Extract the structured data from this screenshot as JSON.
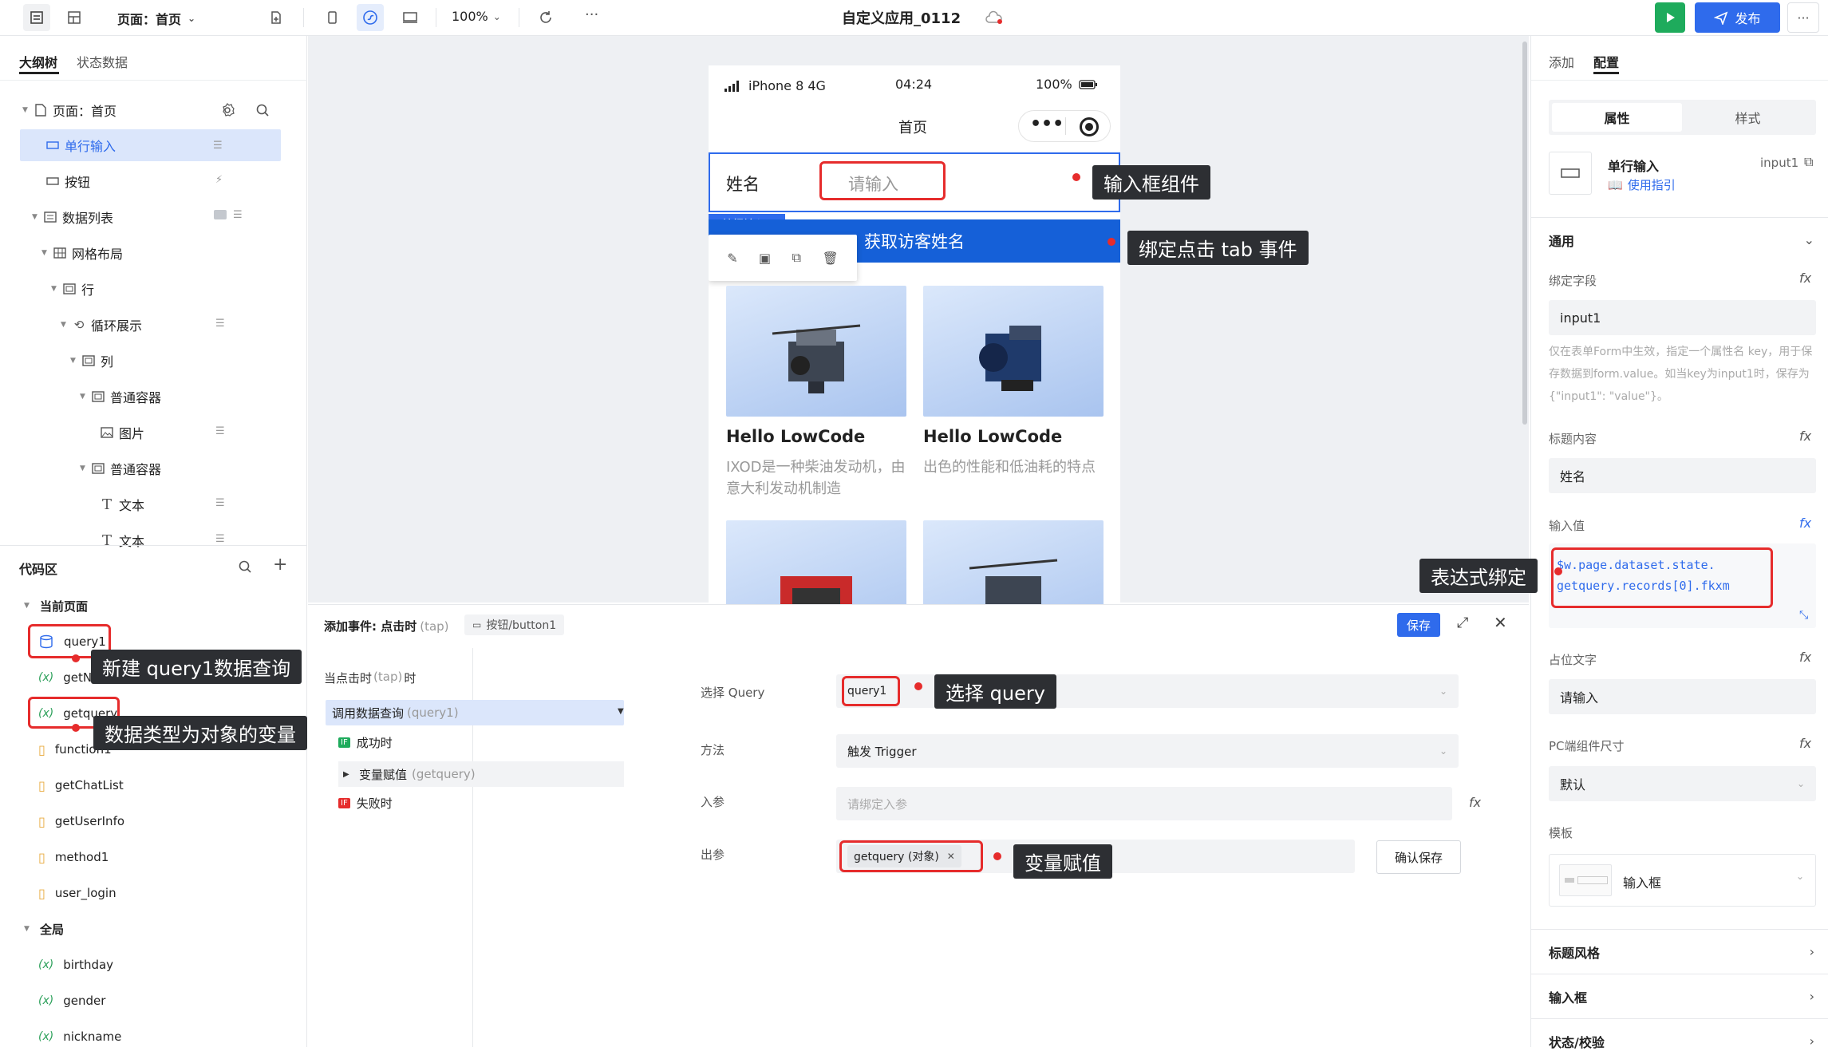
{
  "topbar": {
    "page_select": "页面：首页",
    "zoom": "100%",
    "app_title": "自定义应用_0112",
    "more": "···",
    "publish": "发布"
  },
  "left": {
    "tabs": [
      "大纲树",
      "状态数据"
    ],
    "tree": [
      {
        "label": "页面：首页"
      },
      {
        "label": "单行输入"
      },
      {
        "label": "按钮"
      },
      {
        "label": "数据列表"
      },
      {
        "label": "网格布局"
      },
      {
        "label": "行"
      },
      {
        "label": "循环展示"
      },
      {
        "label": "列"
      },
      {
        "label": "普通容器"
      },
      {
        "label": "图片"
      },
      {
        "label": "普通容器"
      },
      {
        "label": "文本"
      },
      {
        "label": "文本"
      }
    ],
    "code_title": "代码区",
    "current_page": "当前页面",
    "items": [
      {
        "label": "query1"
      },
      {
        "label": "getNowTime"
      },
      {
        "label": "getquery"
      },
      {
        "label": "function1"
      },
      {
        "label": "getChatList"
      },
      {
        "label": "getUserInfo"
      },
      {
        "label": "method1"
      },
      {
        "label": "user_login"
      }
    ],
    "global": "全局",
    "globals": [
      {
        "label": "birthday"
      },
      {
        "label": "gender"
      },
      {
        "label": "nickname"
      }
    ]
  },
  "phone": {
    "carrier": "iPhone 8  4G",
    "time": "04:24",
    "battery": "100%",
    "title": "首页",
    "field_label": "姓名",
    "placeholder": "请输入",
    "tag": "单行输入",
    "button": "获取访客姓名",
    "cards": [
      {
        "title": "Hello LowCode",
        "desc": "IXOD是一种柴油发动机，由意大利发动机制造"
      },
      {
        "title": "Hello LowCode",
        "desc": "出色的性能和低油耗的特点"
      }
    ]
  },
  "callouts": {
    "input_component": "输入框组件",
    "bind_tap": "绑定点击 tab 事件",
    "expr_bind": "表达式绑定",
    "new_query": "新建 query1数据查询",
    "object_var": "数据类型为对象的变量",
    "select_query": "选择 query",
    "var_assign": "变量赋值"
  },
  "event": {
    "title": "添加事件: 点击时",
    "title_tag": "(tap)",
    "target": "按钮/button1",
    "save": "保存",
    "when": "当点击时",
    "when_tag": "(tap)",
    "when_suffix": "时",
    "action": "调用数据查询",
    "action_tag": "(query1)",
    "success": "成功时",
    "assign": "变量赋值",
    "assign_tag": "(getquery)",
    "fail": "失败时",
    "labels": {
      "query": "选择 Query",
      "method": "方法",
      "in": "入参",
      "out": "出参"
    },
    "query_value": "query1",
    "method_value": "触发 Trigger",
    "in_placeholder": "请绑定入参",
    "out_value": "getquery  (对象)",
    "confirm": "确认保存"
  },
  "right": {
    "tabs": [
      "添加",
      "配置"
    ],
    "subtabs": [
      "属性",
      "样式"
    ],
    "comp_name": "单行输入",
    "comp_id": "input1",
    "guide": "使用指引",
    "general": "通用",
    "bind_label": "绑定字段",
    "bind_value": "input1",
    "bind_help": "仅在表单Form中生效，指定一个属性名 key，用于保存数据到form.value。如当key为input1时，保存为{\"input1\": \"value\"}。",
    "title_label": "标题内容",
    "title_value": "姓名",
    "input_label": "输入值",
    "expr_line1": "$w.page.dataset.state.",
    "expr_line2": "getquery.records[0].fkxm",
    "placeholder_label": "占位文字",
    "placeholder_value": "请输入",
    "size_label": "PC端组件尺寸",
    "size_value": "默认",
    "template_label": "模板",
    "template_value": "输入框",
    "sections": [
      "标题风格",
      "输入框",
      "状态/校验"
    ]
  }
}
